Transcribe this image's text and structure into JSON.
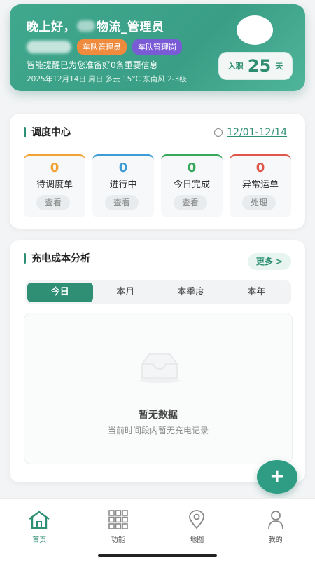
{
  "header": {
    "greeting": "晚上好，",
    "org_suffix": "物流_管理员",
    "tags": [
      "车队管理员",
      "车队管理岗"
    ],
    "tip": "智能提醒已为您准备好0条重要信息",
    "weather": "2025年12月14日 周日 多云 15°C 东南风 2-3级",
    "days_label": "入职",
    "days_value": "25",
    "days_unit": "天"
  },
  "dispatch": {
    "title": "调度中心",
    "date_range": "12/01-12/14",
    "stats": [
      {
        "value": "0",
        "label": "待调度单",
        "action": "查看",
        "color": "#f0a234"
      },
      {
        "value": "0",
        "label": "进行中",
        "action": "查看",
        "color": "#3d9bd6"
      },
      {
        "value": "0",
        "label": "今日完成",
        "action": "查看",
        "color": "#38a85c"
      },
      {
        "value": "0",
        "label": "异常运单",
        "action": "处理",
        "color": "#e0564a"
      }
    ]
  },
  "charge": {
    "title": "充电成本分析",
    "more": "更多 >",
    "tabs": [
      "今日",
      "本月",
      "本季度",
      "本年"
    ],
    "empty_title": "暂无数据",
    "empty_sub": "当前时间段内暂无充电记录"
  },
  "fab": "+",
  "nav": [
    "首页",
    "功能",
    "地图",
    "我的"
  ]
}
